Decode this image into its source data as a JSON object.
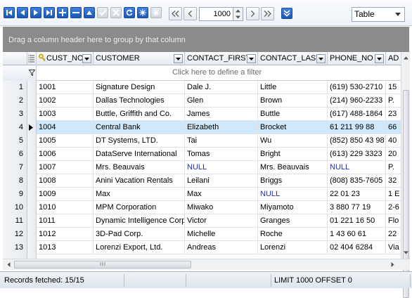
{
  "toolbar": {
    "data_nav_icons": [
      "first-record-icon",
      "prior-record-icon",
      "next-record-icon",
      "last-record-icon",
      "insert-record-icon",
      "delete-record-icon",
      "edit-record-icon",
      "post-edit-icon",
      "cancel-edit-icon",
      "refresh-icon",
      "apply-icon",
      "clear-icon"
    ],
    "page_nav_icons": [
      "first-page-icon",
      "prior-page-icon",
      "next-page-icon",
      "last-page-icon"
    ],
    "limit_value": "1000",
    "view_mode": "Table"
  },
  "group_panel_text": "Drag a column header here to group by that column",
  "filter_row_text": "Click here to define a filter",
  "columns": [
    "CUST_NO",
    "CUSTOMER",
    "CONTACT_FIRST",
    "CONTACT_LAST",
    "PHONE_NO",
    "AD"
  ],
  "rows": [
    {
      "n": "1",
      "cells": [
        "1001",
        "Signature Design",
        "Dale J.",
        "Little",
        "(619) 530-2710",
        "15"
      ]
    },
    {
      "n": "2",
      "cells": [
        "1002",
        "Dallas Technologies",
        "Glen",
        "Brown",
        "(214) 960-2233",
        "P."
      ]
    },
    {
      "n": "3",
      "cells": [
        "1003",
        "Buttle, Griffith and Co.",
        "James",
        "Buttle",
        "(617) 488-1864",
        "23"
      ]
    },
    {
      "n": "4",
      "cells": [
        "1004",
        "Central Bank",
        "Elizabeth",
        "Brocket",
        "61 211 99 88",
        "66"
      ]
    },
    {
      "n": "5",
      "cells": [
        "1005",
        "DT Systems, LTD.",
        "Tai",
        "Wu",
        "(852) 850 43 98",
        "40"
      ]
    },
    {
      "n": "6",
      "cells": [
        "1006",
        "DataServe International",
        "Tomas",
        "Bright",
        "(613) 229 3323",
        "20"
      ]
    },
    {
      "n": "7",
      "cells": [
        "1007",
        "Mrs. Beauvais",
        "NULL",
        "Mrs. Beauvais",
        "NULL",
        "P."
      ]
    },
    {
      "n": "8",
      "cells": [
        "1008",
        "Anini Vacation Rentals",
        "Leilani",
        "Briggs",
        "(808) 835-7605",
        "32"
      ]
    },
    {
      "n": "9",
      "cells": [
        "1009",
        "Max",
        "Max",
        "NULL",
        "22 01 23",
        "1 E"
      ]
    },
    {
      "n": "10",
      "cells": [
        "1010",
        "MPM Corporation",
        "Miwako",
        "Miyamoto",
        "3 880 77 19",
        "2-6"
      ]
    },
    {
      "n": "11",
      "cells": [
        "1011",
        "Dynamic Intelligence Corp",
        "Victor",
        "Granges",
        "01 221 16 50",
        "Flo"
      ]
    },
    {
      "n": "12",
      "cells": [
        "1012",
        "3D-Pad Corp.",
        "Michelle",
        "Roche",
        "1 43 60 61",
        "22"
      ]
    },
    {
      "n": "13",
      "cells": [
        "1013",
        "Lorenzi Export, Ltd.",
        "Andreas",
        "Lorenzi",
        "02 404 6284",
        "Via"
      ]
    }
  ],
  "current_row": "4",
  "null_text": "NULL",
  "status": {
    "records": "Records fetched: 15/15",
    "limit": "LIMIT 1000 OFFSET 0"
  }
}
